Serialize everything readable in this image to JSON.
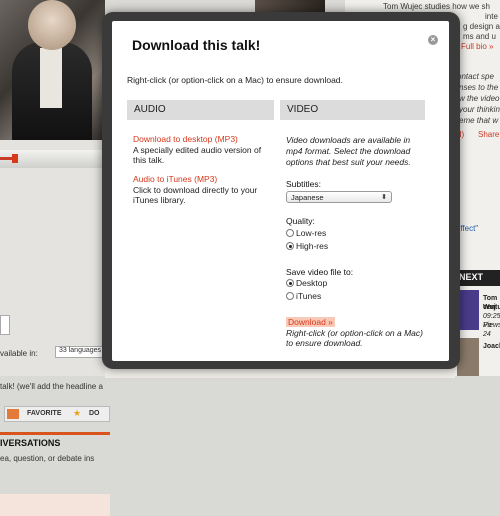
{
  "background": {
    "right": {
      "line1": "Tom Wujec studies how we sh",
      "line2": "inte",
      "line3": "g design a",
      "line4": "ms and u",
      "full_bio": "Full bio »",
      "ontact": "ontact spe",
      "lines": [
        "nses to the",
        "w the video",
        "your thinkin",
        "eme that w"
      ],
      "share_left": "d)",
      "share": "Share",
      "effect": "Effect\"",
      "next": "NEXT",
      "next_title": "Tom Wuj",
      "next_sub": "century",
      "next_date": "09:25 Po",
      "next_views": "Views 24",
      "joachi": "Joachi"
    },
    "left": {
      "available": "vailable in:",
      "languages": "33 languages",
      "talk": "talk! (we'll add the headline a",
      "favorite": "FAVORITE",
      "download_short": "DO",
      "conversations": "IVERSATIONS",
      "conv_sub": "ea, question, or debate ins"
    }
  },
  "dialog": {
    "title": "Download this talk!",
    "close_icon": "close-icon",
    "intro": "Right-click (or option-click on a Mac) to ensure download.",
    "audio": {
      "heading": "AUDIO",
      "mp3_link": "Download to desktop (MP3)",
      "mp3_desc": "A specially edited audio version of this talk.",
      "itunes_link": "Audio to iTunes (MP3)",
      "itunes_desc": "Click to download directly to your iTunes library."
    },
    "video": {
      "heading": "VIDEO",
      "desc": "Video downloads are available in mp4 format. Select the download options that best suit your needs.",
      "subtitles_label": "Subtitles:",
      "subtitles_value": "Japanese",
      "quality_label": "Quality:",
      "quality_options": [
        "Low-res",
        "High-res"
      ],
      "quality_selected": "High-res",
      "save_label": "Save video file to:",
      "save_options": [
        "Desktop",
        "iTunes"
      ],
      "save_selected": "Desktop",
      "download_link": "Download »",
      "download_note": "Right-click (or option-click on a Mac) to ensure download."
    }
  }
}
